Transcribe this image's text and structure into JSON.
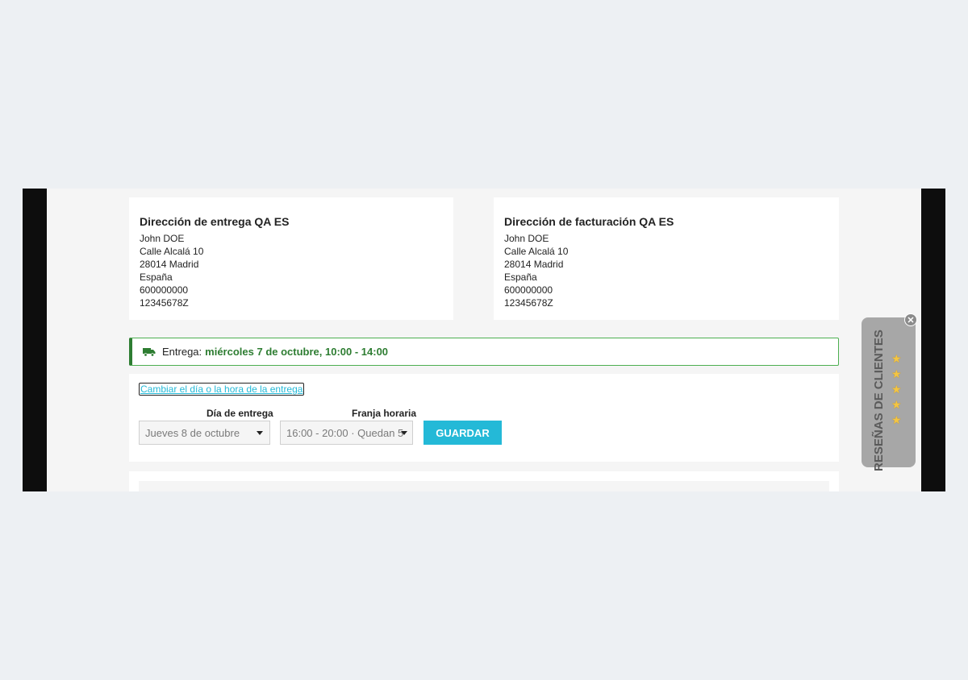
{
  "shipping_address": {
    "title": "Dirección de entrega QA ES",
    "name": "John DOE",
    "street": "Calle Alcalá 10",
    "city": "28014 Madrid",
    "country": "España",
    "phone": "600000000",
    "tax_id": "12345678Z"
  },
  "billing_address": {
    "title": "Dirección de facturación QA ES",
    "name": "John DOE",
    "street": "Calle Alcalá 10",
    "city": "28014 Madrid",
    "country": "España",
    "phone": "600000000",
    "tax_id": "12345678Z"
  },
  "delivery": {
    "label": "Entrega:",
    "value": "miércoles 7 de octubre, 10:00 - 14:00",
    "icon": "truck-icon",
    "accent_color": "#2e7d32"
  },
  "change_delivery": {
    "link_text": "Cambiar el día o la hora de la entrega",
    "day_label": "Día de entrega",
    "day_selected": "Jueves 8 de octubre",
    "slot_label": "Franja horaria",
    "slot_selected": "16:00 - 20:00 · Quedan 5",
    "save_label": "GUARDAR",
    "button_color": "#24b9d7"
  },
  "reviews_widget": {
    "label": "RESEÑAS DE CLIENTES",
    "star_count": 5,
    "close_icon": "close-icon"
  }
}
